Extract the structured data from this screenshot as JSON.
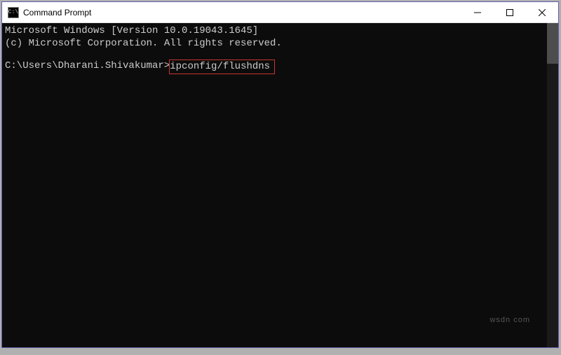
{
  "window": {
    "title": "Command Prompt",
    "icon_label": "C:\\"
  },
  "terminal": {
    "line1": "Microsoft Windows [Version 10.0.19043.1645]",
    "line2": "(c) Microsoft Corporation. All rights reserved.",
    "prompt": "C:\\Users\\Dharani.Shivakumar>",
    "command": "ipconfig/flushdns"
  },
  "watermark": "wsdn com"
}
